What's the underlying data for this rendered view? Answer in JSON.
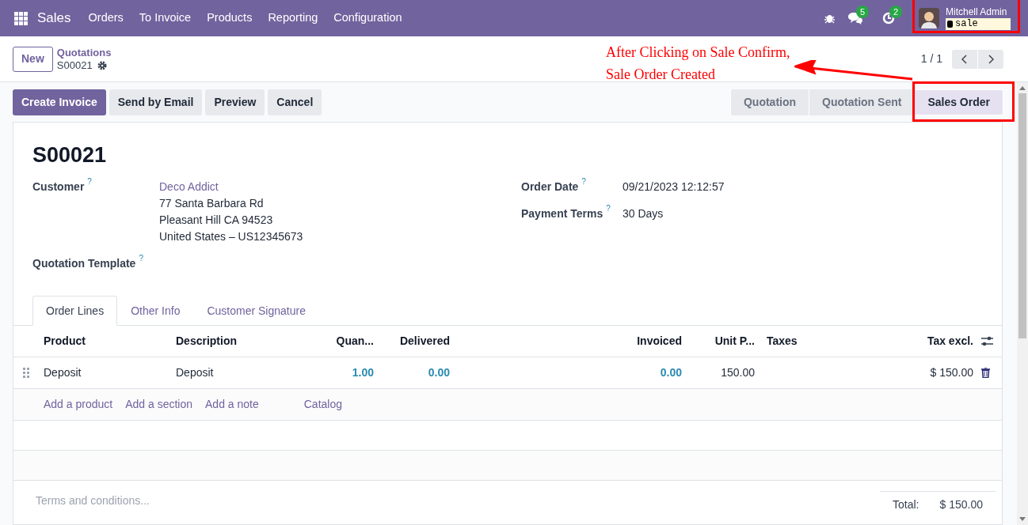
{
  "navbar": {
    "app": "Sales",
    "menu": [
      "Orders",
      "To Invoice",
      "Products",
      "Reporting",
      "Configuration"
    ],
    "messages_badge": "5",
    "activities_badge": "2",
    "user": {
      "name": "Mitchell Admin",
      "database": "sale"
    }
  },
  "control_panel": {
    "new_button": "New",
    "breadcrumb": "Quotations",
    "record": "S00021",
    "pager": "1 / 1"
  },
  "actions": [
    {
      "label": "Create Invoice",
      "kind": "primary"
    },
    {
      "label": "Send by Email",
      "kind": "secondary"
    },
    {
      "label": "Preview",
      "kind": "secondary"
    },
    {
      "label": "Cancel",
      "kind": "secondary"
    }
  ],
  "statusbar": [
    {
      "label": "Quotation",
      "selected": false
    },
    {
      "label": "Quotation Sent",
      "selected": false
    },
    {
      "label": "Sales Order",
      "selected": true
    }
  ],
  "form": {
    "title": "S00021",
    "customer": {
      "label": "Customer",
      "help": "?",
      "name": "Deco Addict",
      "address": [
        "77 Santa Barbara Rd",
        "Pleasant Hill CA 94523",
        "United States – US12345673"
      ]
    },
    "quotation_template": {
      "label": "Quotation Template",
      "help": "?"
    },
    "order_date": {
      "label": "Order Date",
      "help": "?",
      "value": "09/21/2023 12:12:57"
    },
    "payment_terms": {
      "label": "Payment Terms",
      "help": "?",
      "value": "30 Days"
    }
  },
  "tabs": [
    {
      "label": "Order Lines",
      "selected": true
    },
    {
      "label": "Other Info",
      "selected": false
    },
    {
      "label": "Customer Signature",
      "selected": false
    }
  ],
  "table": {
    "columns": [
      "Product",
      "Description",
      "Quan...",
      "Delivered",
      "Invoiced",
      "Unit P...",
      "Taxes",
      "Tax excl."
    ],
    "rows": [
      {
        "product": "Deposit",
        "description": "Deposit",
        "quantity": "1.00",
        "delivered": "0.00",
        "invoiced": "0.00",
        "unit_price": "150.00",
        "tax_excl": "$ 150.00"
      }
    ],
    "add_links": [
      "Add a product",
      "Add a section",
      "Add a note",
      "Catalog"
    ]
  },
  "terms": {
    "placeholder": "Terms and conditions..."
  },
  "total": {
    "label": "Total:",
    "value": "$ 150.00"
  },
  "annotation": {
    "lines": [
      "After Clicking on Sale Confirm,",
      "Sale Order Created"
    ]
  }
}
